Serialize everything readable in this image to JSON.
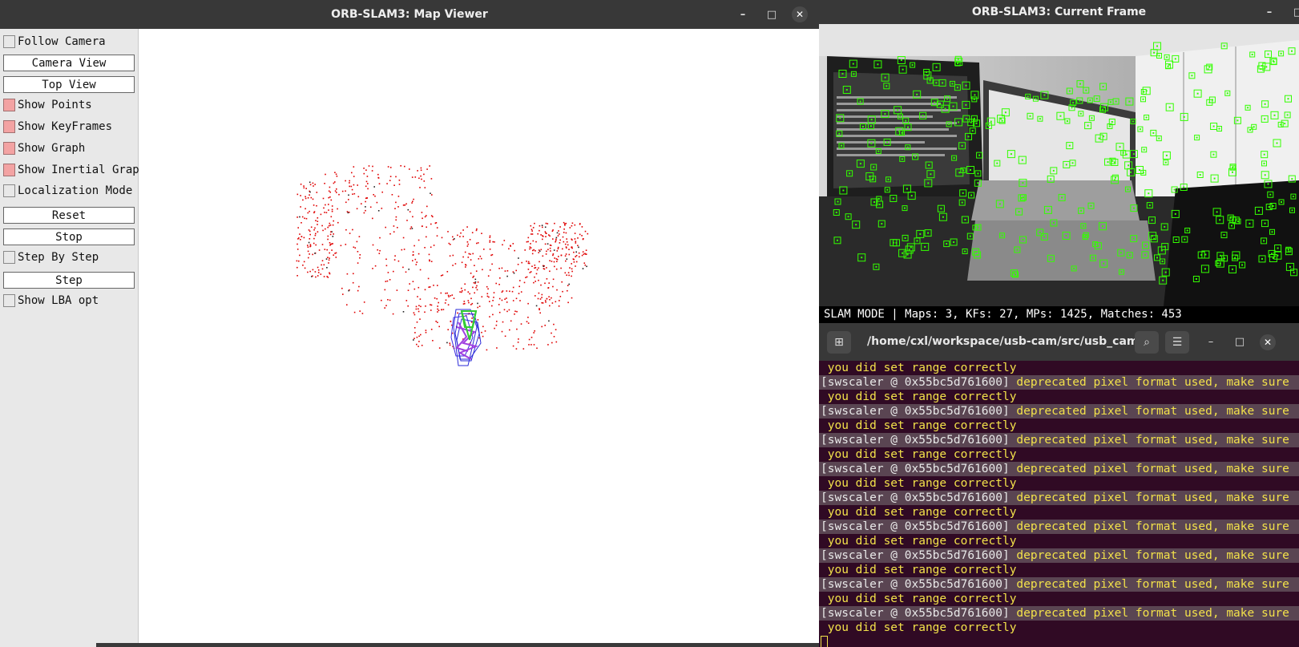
{
  "map_viewer": {
    "title": "ORB-SLAM3: Map Viewer",
    "controls": {
      "minimize": "–",
      "maximize": "□",
      "close": "✕"
    },
    "panel": {
      "follow_camera": {
        "label": "Follow Camera",
        "checked": false
      },
      "camera_view": "Camera View",
      "top_view": "Top View",
      "show_points": {
        "label": "Show Points",
        "checked": true
      },
      "show_keyframes": {
        "label": "Show KeyFrames",
        "checked": true
      },
      "show_graph": {
        "label": "Show Graph",
        "checked": true
      },
      "show_inertial_graph": {
        "label": "Show Inertial Graph",
        "checked": true
      },
      "localization_mode": {
        "label": "Localization Mode",
        "checked": false
      },
      "reset": "Reset",
      "stop": "Stop",
      "step_by_step": {
        "label": "Step By Step",
        "checked": false
      },
      "step": "Step",
      "show_lba_opt": {
        "label": "Show LBA opt",
        "checked": false
      }
    },
    "colors": {
      "map_points": "#e00000",
      "keyframes": "#2a2ad8",
      "current_camera": "#33cc33",
      "graph": "#a040e0"
    }
  },
  "current_frame": {
    "title": "ORB-SLAM3: Current Frame",
    "controls": {
      "minimize": "–",
      "maximize": "□",
      "close": "✕"
    },
    "status": "SLAM MODE |  Maps: 3, KFs: 27, MPs: 1425, Matches: 453",
    "colors": {
      "features": "#33ff00"
    }
  },
  "terminal": {
    "title": "/home/cxl/workspace/usb-cam/src/usb_cam...",
    "new_tab_icon": "new-tab-icon",
    "search_icon": "search-icon",
    "menu_icon": "menu-icon",
    "controls": {
      "minimize": "–",
      "maximize": "□",
      "close": "✕"
    },
    "lines": [
      {
        "prefix": "",
        "text": " you did set range correctly"
      },
      {
        "prefix": "[swscaler @ 0x55bc5d761600]",
        "text": " deprecated pixel format used, make sure"
      },
      {
        "prefix": "",
        "text": " you did set range correctly"
      },
      {
        "prefix": "[swscaler @ 0x55bc5d761600]",
        "text": " deprecated pixel format used, make sure"
      },
      {
        "prefix": "",
        "text": " you did set range correctly"
      },
      {
        "prefix": "[swscaler @ 0x55bc5d761600]",
        "text": " deprecated pixel format used, make sure"
      },
      {
        "prefix": "",
        "text": " you did set range correctly"
      },
      {
        "prefix": "[swscaler @ 0x55bc5d761600]",
        "text": " deprecated pixel format used, make sure"
      },
      {
        "prefix": "",
        "text": " you did set range correctly"
      },
      {
        "prefix": "[swscaler @ 0x55bc5d761600]",
        "text": " deprecated pixel format used, make sure"
      },
      {
        "prefix": "",
        "text": " you did set range correctly"
      },
      {
        "prefix": "[swscaler @ 0x55bc5d761600]",
        "text": " deprecated pixel format used, make sure"
      },
      {
        "prefix": "",
        "text": " you did set range correctly"
      },
      {
        "prefix": "[swscaler @ 0x55bc5d761600]",
        "text": " deprecated pixel format used, make sure"
      },
      {
        "prefix": "",
        "text": " you did set range correctly"
      },
      {
        "prefix": "[swscaler @ 0x55bc5d761600]",
        "text": " deprecated pixel format used, make sure"
      },
      {
        "prefix": "",
        "text": " you did set range correctly"
      },
      {
        "prefix": "[swscaler @ 0x55bc5d761600]",
        "text": " deprecated pixel format used, make sure"
      },
      {
        "prefix": "",
        "text": " you did set range correctly"
      }
    ]
  }
}
